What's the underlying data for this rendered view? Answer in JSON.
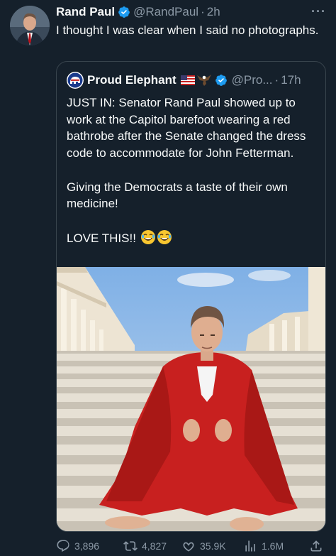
{
  "tweet": {
    "display_name": "Rand Paul",
    "handle": "@RandPaul",
    "separator": "·",
    "time": "2h",
    "more": "···",
    "text": "I thought I was clear when I said no photographs.",
    "verified_color": "#1d9bf0"
  },
  "quote": {
    "display_name": "Proud Elephant",
    "handle": "@Pro...",
    "separator": "·",
    "time": "17h",
    "paragraph1": "JUST IN: Senator Rand Paul showed up to work at the Capitol barefoot wearing a red bathrobe after the Senate changed the dress code to accommodate for John Fetterman.",
    "paragraph2": "Giving the Democrats a taste of their own medicine!",
    "paragraph3": "LOVE THIS!!",
    "emojis": [
      "laughing-emoji",
      "laughing-emoji"
    ]
  },
  "actions": {
    "replies": "3,896",
    "retweets": "4,827",
    "likes": "35.9K",
    "views": "1.6M"
  },
  "colors": {
    "background": "#15202b",
    "text": "#f7f9f9",
    "muted": "#8b98a5",
    "border": "#38444d",
    "robe": "#c8201f"
  }
}
